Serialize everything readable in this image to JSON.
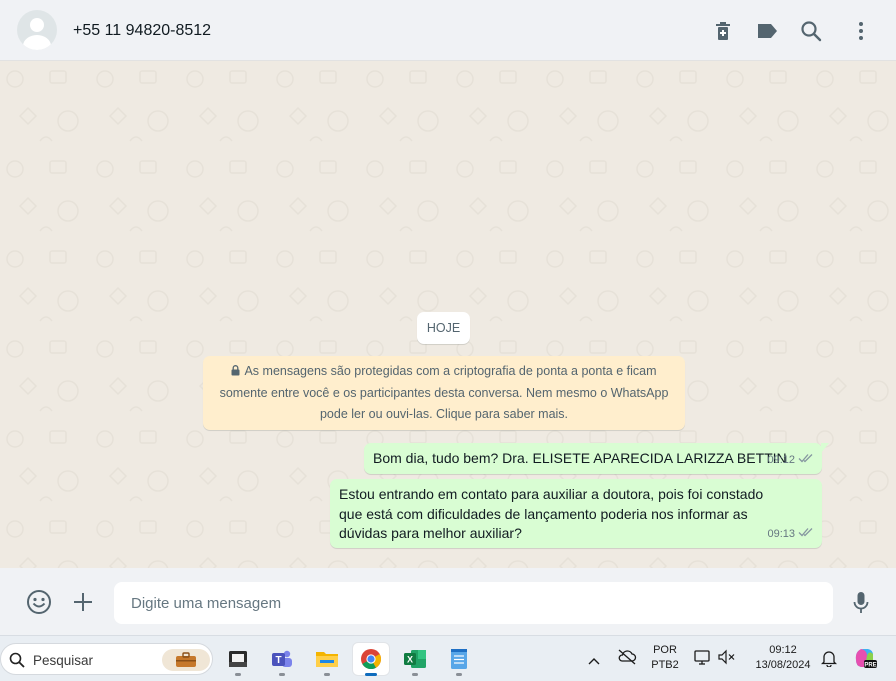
{
  "header": {
    "contact": "+55 11 94820-8512",
    "icons": [
      "delete-icon",
      "label-icon",
      "search-icon",
      "menu-icon"
    ]
  },
  "chat": {
    "date_chip": "HOJE",
    "encryption_notice": "As mensagens são protegidas com a criptografia de ponta a ponta e ficam somente entre você e os participantes desta conversa. Nem mesmo o WhatsApp pode ler ou ouvi-las. Clique para saber mais.",
    "messages": [
      {
        "text": "Bom dia, tudo bem? Dra. ELISETE APARECIDA LARIZZA BETTIN",
        "time": "09:12",
        "status": "read"
      },
      {
        "text": "Estou entrando em contato para auxiliar a doutora, pois foi constado que está com dificuldades de lançamento poderia nos informar as dúvidas para melhor auxiliar?",
        "time": "09:13",
        "status": "read"
      }
    ]
  },
  "composer": {
    "placeholder": "Digite uma mensagem",
    "icons": [
      "emoji-icon",
      "plus-icon",
      "microphone-icon"
    ]
  },
  "taskbar": {
    "search_label": "Pesquisar",
    "apps": [
      "file-explorer-icon",
      "teams-icon",
      "folder-icon",
      "chrome-icon",
      "excel-icon",
      "notepad-icon"
    ],
    "active_app": "chrome-icon",
    "language_line1": "POR",
    "language_line2": "PTB2",
    "time": "09:12",
    "date": "13/08/2024"
  },
  "colors": {
    "outgoing_bubble": "#d9fdd3",
    "notice_bg": "#ffeecd",
    "chat_bg": "#efeae2",
    "header_bg": "#f0f2f5",
    "read_tick": "#53bdeb"
  }
}
